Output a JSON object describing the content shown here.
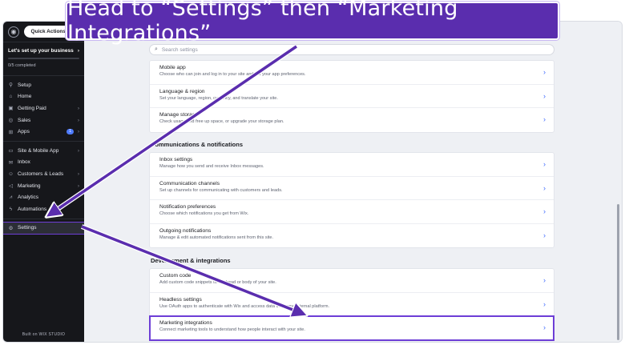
{
  "banner": {
    "text": "Head to “Settings” then “Marketing Integrations”"
  },
  "sidebar": {
    "quick_actions": "Quick Actions",
    "setup_title": "Let's set up your business",
    "setup_progress": "0/5 completed",
    "progress_fraction": 0,
    "items_top": [
      {
        "label": "Setup",
        "icon": "rocket-icon",
        "glyph": "⚲"
      },
      {
        "label": "Home",
        "icon": "home-icon",
        "glyph": "⌂"
      },
      {
        "label": "Getting Paid",
        "icon": "wallet-icon",
        "glyph": "▣"
      },
      {
        "label": "Sales",
        "icon": "dollar-icon",
        "glyph": "◎"
      },
      {
        "label": "Apps",
        "icon": "apps-icon",
        "glyph": "⊞"
      }
    ],
    "apps_badge": "1",
    "items_mid": [
      {
        "label": "Site & Mobile App",
        "icon": "monitor-icon",
        "glyph": "▭"
      },
      {
        "label": "Inbox",
        "icon": "inbox-icon",
        "glyph": "✉"
      },
      {
        "label": "Customers & Leads",
        "icon": "people-icon",
        "glyph": "☺"
      },
      {
        "label": "Marketing",
        "icon": "megaphone-icon",
        "glyph": "◁"
      },
      {
        "label": "Analytics",
        "icon": "chart-icon",
        "glyph": "⩘"
      },
      {
        "label": "Automations",
        "icon": "bolt-icon",
        "glyph": "ϟ"
      }
    ],
    "settings_label": "Settings",
    "built_on": "Built on WIX STUDIO"
  },
  "search": {
    "placeholder": "Search settings"
  },
  "card1": [
    {
      "title": "Mobile app",
      "desc": "Choose who can join and log in to your site and set your app preferences."
    },
    {
      "title": "Language & region",
      "desc": "Set your language, region, currency, and translate your site."
    },
    {
      "title": "Manage storage",
      "desc": "Check usage and free up space, or upgrade your storage plan."
    }
  ],
  "group2": "Communications & notifications",
  "card2": [
    {
      "title": "Inbox settings",
      "desc": "Manage how you send and receive Inbox messages."
    },
    {
      "title": "Communication channels",
      "desc": "Set up channels for communicating with customers and leads."
    },
    {
      "title": "Notification preferences",
      "desc": "Choose which notifications you get from Wix."
    },
    {
      "title": "Outgoing notifications",
      "desc": "Manage & edit automated notifications sent from this site."
    }
  ],
  "group3": "Development & integrations",
  "card3": [
    {
      "title": "Custom code",
      "desc": "Add custom code snippets to the head or body of your site."
    },
    {
      "title": "Headless settings",
      "desc": "Use OAuth apps to authenticate with Wix and access data from any external platform."
    },
    {
      "title": "Marketing integrations",
      "desc": "Connect marketing tools to understand how people interact with your site."
    }
  ],
  "colors": {
    "accent": "#5a2dae",
    "highlight": "#6d3ed6",
    "link": "#3f6bff",
    "sidebar_bg": "#16171b"
  }
}
